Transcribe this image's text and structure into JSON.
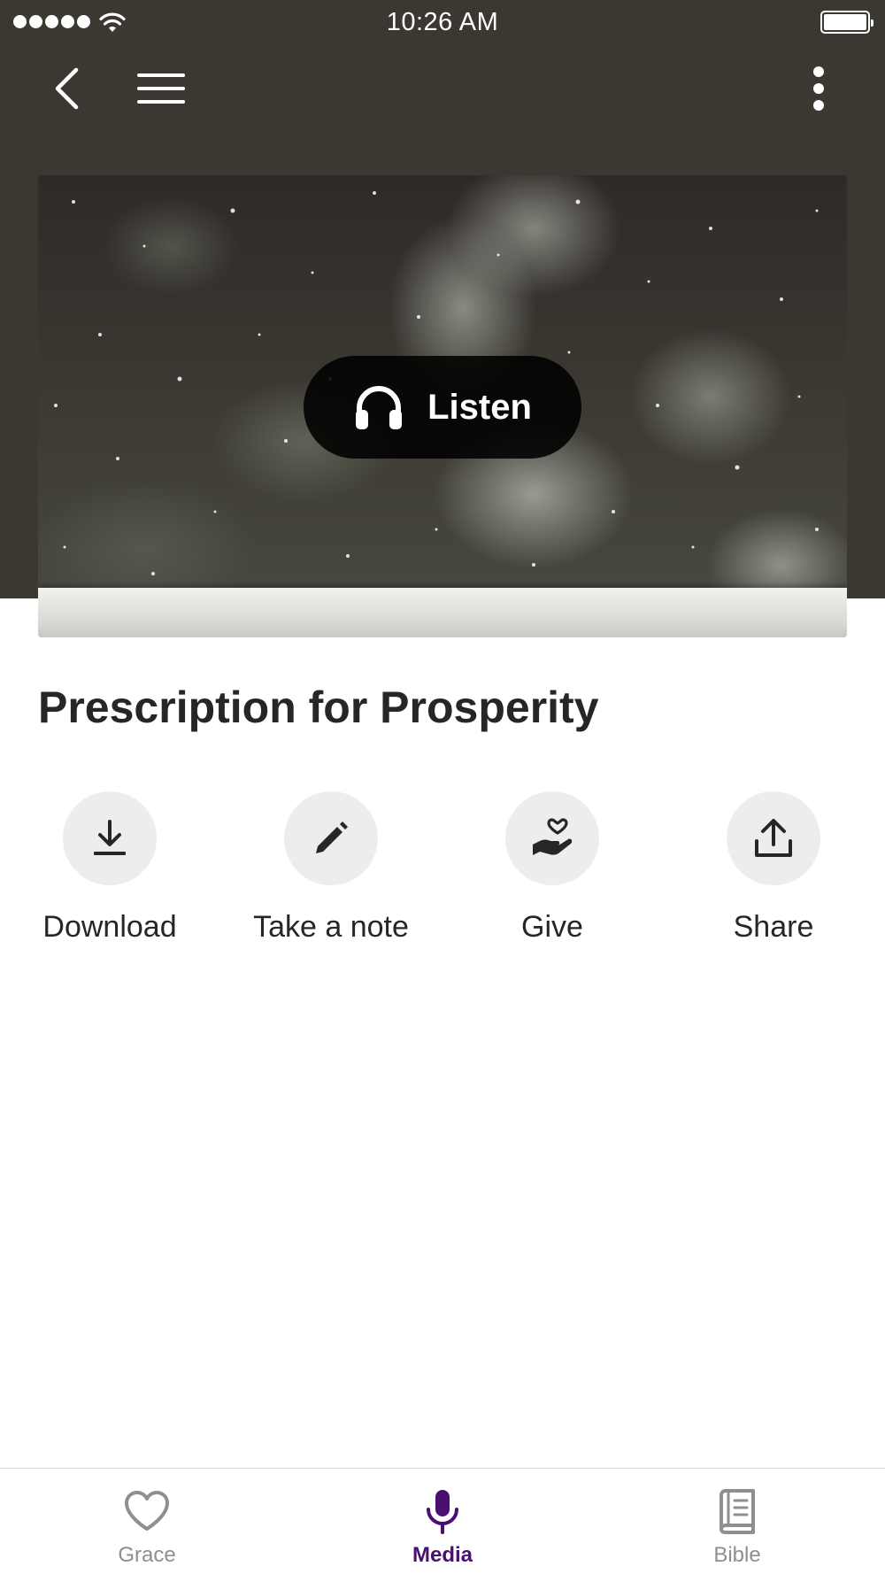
{
  "status_bar": {
    "time": "10:26 AM"
  },
  "hero": {
    "listen_label": "Listen"
  },
  "content": {
    "title": "Prescription for Prosperity"
  },
  "actions": [
    {
      "label": "Download",
      "icon": "download-icon"
    },
    {
      "label": "Take a note",
      "icon": "pencil-icon"
    },
    {
      "label": "Give",
      "icon": "giving-hand-icon"
    },
    {
      "label": "Share",
      "icon": "share-icon"
    }
  ],
  "tabs": [
    {
      "label": "Grace",
      "icon": "heart-icon",
      "active": false
    },
    {
      "label": "Media",
      "icon": "microphone-icon",
      "active": true
    },
    {
      "label": "Bible",
      "icon": "bible-book-icon",
      "active": false
    }
  ],
  "colors": {
    "header_background": "#3b3831",
    "active_tab": "#4b0f72",
    "inactive_tab": "#8e8e93",
    "action_circle": "#ededef",
    "listen_button": "#000000"
  }
}
